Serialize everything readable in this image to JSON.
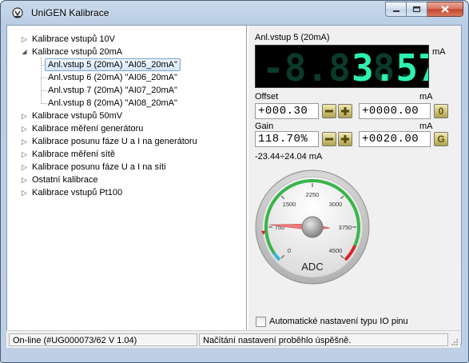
{
  "window": {
    "title": "UniGEN Kalibrace"
  },
  "tree": {
    "items": [
      {
        "label": "Kalibrace vstupů 10V",
        "expander": "▷",
        "level": 0
      },
      {
        "label": "Kalibrace vstupů 20mA",
        "expander": "◢",
        "level": 0
      },
      {
        "label": "Anl.vstup 5 (20mA)  \"AI05_20mA\"",
        "level": 1,
        "selected": true
      },
      {
        "label": "Anl.vstup 6 (20mA)  \"AI06_20mA\"",
        "level": 1
      },
      {
        "label": "Anl.vstup 7 (20mA)  \"AI07_20mA\"",
        "level": 1
      },
      {
        "label": "Anl.vstup 8 (20mA)  \"AI08_20mA\"",
        "level": 1
      },
      {
        "label": "Kalibrace vstupů 50mV",
        "expander": "▷",
        "level": 0
      },
      {
        "label": "Kalibrace měření generátoru",
        "expander": "▷",
        "level": 0
      },
      {
        "label": "Kalibrace posunu fáze U a I na generátoru",
        "expander": "▷",
        "level": 0
      },
      {
        "label": "Kalibrace měření sítě",
        "expander": "▷",
        "level": 0
      },
      {
        "label": "Kalibrace posunu fáze U a I na síti",
        "expander": "▷",
        "level": 0
      },
      {
        "label": "Ostatní kalibrace",
        "expander": "▷",
        "level": 0
      },
      {
        "label": "Kalibrace vstupů Pt100",
        "expander": "▷",
        "level": 0
      }
    ]
  },
  "panel": {
    "title": "Anl.vstup 5 (20mA)",
    "display": {
      "dim_digits": "-8.8.8.",
      "value": "3.57",
      "unit": "mA"
    },
    "offset": {
      "label": "Offset",
      "unit": "mA",
      "value": "+000.30",
      "step_value": "+0000.00",
      "reset_label": "0"
    },
    "gain": {
      "label": "Gain",
      "unit": "mA",
      "value": "118.70%",
      "step_value": "+0020.00",
      "reset_label": "G"
    },
    "range": "-23.44÷24.04 mA",
    "gauge": {
      "label": "ADC",
      "ticks": [
        "0",
        "750",
        "1500",
        "2250",
        "3000",
        "3750",
        "4500"
      ],
      "min": 0,
      "max": 4500,
      "value": 800,
      "zero_marker": 600
    },
    "checkbox": {
      "label": "Automatické nastavení typu IO pinu",
      "checked": false
    }
  },
  "status": {
    "connection": "On-line (#UG000073/62  V 1.04)",
    "message": "Načítání nastavení proběhlo úspěšně."
  }
}
